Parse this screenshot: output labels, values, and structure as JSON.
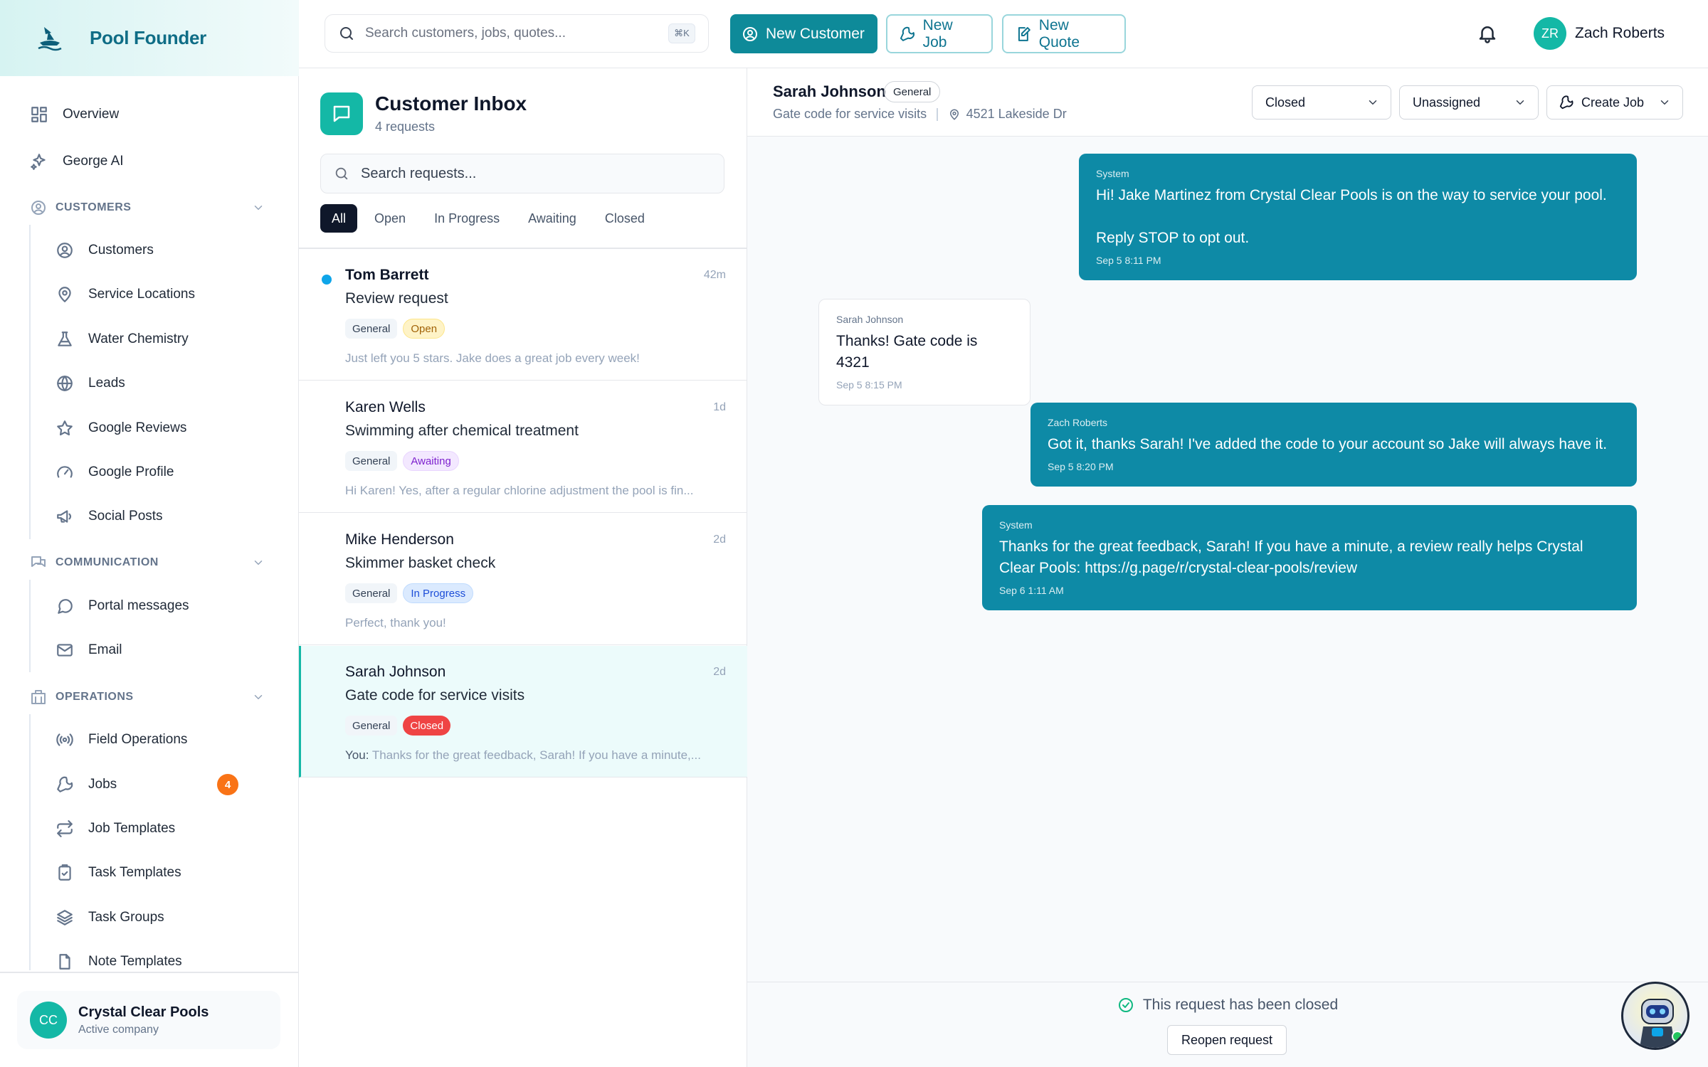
{
  "app": {
    "name": "Pool Founder"
  },
  "sidebar": {
    "overview": "Overview",
    "george": "George AI",
    "sections": {
      "customers": "CUSTOMERS",
      "communication": "COMMUNICATION",
      "operations": "OPERATIONS"
    },
    "customers_items": [
      {
        "label": "Customers",
        "icon": "user-circle-icon"
      },
      {
        "label": "Service Locations",
        "icon": "map-pin-icon"
      },
      {
        "label": "Water Chemistry",
        "icon": "flask-icon"
      },
      {
        "label": "Leads",
        "icon": "globe-icon"
      },
      {
        "label": "Google Reviews",
        "icon": "star-icon"
      },
      {
        "label": "Google Profile",
        "icon": "gauge-icon"
      },
      {
        "label": "Social Posts",
        "icon": "megaphone-icon"
      }
    ],
    "communication_items": [
      {
        "label": "Portal messages",
        "icon": "chat-bubble-icon"
      },
      {
        "label": "Email",
        "icon": "mail-icon"
      }
    ],
    "operations_items": [
      {
        "label": "Field Operations",
        "icon": "radio-icon"
      },
      {
        "label": "Jobs",
        "icon": "wrench-icon",
        "badge": "4"
      },
      {
        "label": "Job Templates",
        "icon": "repeat-icon"
      },
      {
        "label": "Task Templates",
        "icon": "clipboard-icon"
      },
      {
        "label": "Task Groups",
        "icon": "layers-icon"
      },
      {
        "label": "Note Templates",
        "icon": "file-icon"
      }
    ],
    "company": {
      "initials": "CC",
      "name": "Crystal Clear Pools",
      "status": "Active company"
    }
  },
  "topbar": {
    "search_placeholder": "Search customers, jobs, quotes...",
    "search_shortcut": "⌘K",
    "new_customer": "New Customer",
    "new_job": "New Job",
    "new_quote": "New Quote",
    "user": {
      "initials": "ZR",
      "name": "Zach Roberts"
    }
  },
  "inbox": {
    "title": "Customer Inbox",
    "count": "4 requests",
    "search_placeholder": "Search requests...",
    "filters": [
      "All",
      "Open",
      "In Progress",
      "Awaiting",
      "Closed"
    ],
    "conversations": [
      {
        "name": "Tom Barrett",
        "time": "42m",
        "subject": "Review request",
        "category": "General",
        "status": "Open",
        "preview": "Just left you 5 stars. Jake does a great job every week!",
        "unread": true
      },
      {
        "name": "Karen Wells",
        "time": "1d",
        "subject": "Swimming after chemical treatment",
        "category": "General",
        "status": "Awaiting",
        "preview": "Hi Karen! Yes, after a regular chlorine adjustment the pool is fin..."
      },
      {
        "name": "Mike Henderson",
        "time": "2d",
        "subject": "Skimmer basket check",
        "category": "General",
        "status": "In Progress",
        "preview": "Perfect, thank you!"
      },
      {
        "name": "Sarah Johnson",
        "time": "2d",
        "subject": "Gate code for service visits",
        "category": "General",
        "status": "Closed",
        "preview_prefix": "You:",
        "preview": "Thanks for the great feedback, Sarah! If you have a minute,...",
        "selected": true
      }
    ]
  },
  "conversation": {
    "customer": "Sarah Johnson",
    "category": "General",
    "subject": "Gate code for service visits",
    "address": "4521 Lakeside Dr",
    "status_select": "Closed",
    "assignee_select": "Unassigned",
    "create_job": "Create Job",
    "messages": [
      {
        "author": "System",
        "body": "Hi! Jake Martinez from Crystal Clear Pools is on the way to service your pool.\n\nReply STOP to opt out.",
        "time": "Sep 5 8:11 PM",
        "direction": "out"
      },
      {
        "author": "Sarah Johnson",
        "body": "Thanks! Gate code is 4321",
        "time": "Sep 5 8:15 PM",
        "direction": "in"
      },
      {
        "author": "Zach Roberts",
        "body": "Got it, thanks Sarah! I've added the code to your account so Jake will always have it.",
        "time": "Sep 5 8:20 PM",
        "direction": "out"
      },
      {
        "author": "System",
        "body": "Thanks for the great feedback, Sarah! If you have a minute, a review really helps Crystal Clear Pools: https://g.page/r/crystal-clear-pools/review",
        "time": "Sep 6 1:11 AM",
        "direction": "out"
      }
    ],
    "closed_notice": "This request has been closed",
    "reopen_button": "Reopen request"
  },
  "colors": {
    "accent": "#0e8a99",
    "teal": "#14b8a6",
    "bubble": "#0e8aa6"
  }
}
